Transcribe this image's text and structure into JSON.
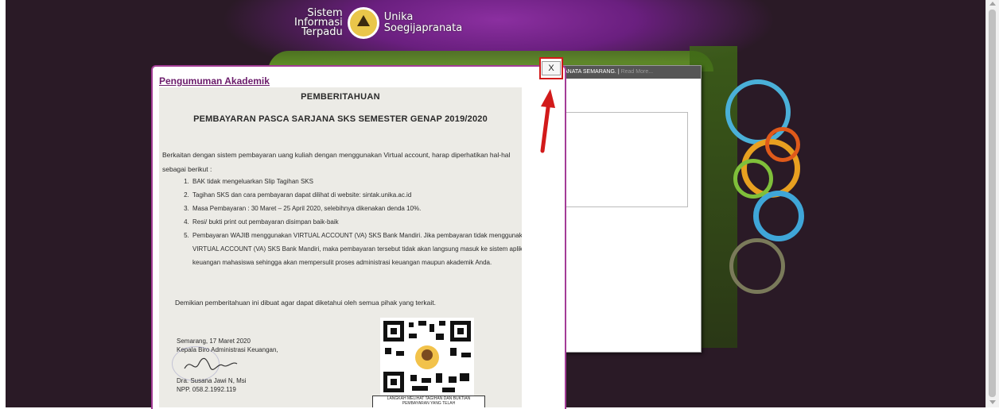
{
  "header": {
    "left_line1": "Sistem",
    "left_line2": "Informasi",
    "left_line3": "Terpadu",
    "right_line1": "Unika",
    "right_line2": "Soegijapranata"
  },
  "back_panel": {
    "bar_text": "ANATA SEMARANG.",
    "read_more": "Read More..."
  },
  "modal": {
    "title": "Pengumuman Akademik",
    "close_label": "X"
  },
  "document": {
    "heading": "PEMBERITAHUAN",
    "subheading": "PEMBAYARAN PASCA SARJANA SKS SEMESTER GENAP 2019/2020",
    "intro": "Berkaitan dengan sistem pembayaran uang kuliah dengan menggunakan Virtual account, harap diperhatikan hal-hal sebagai berikut :",
    "items": [
      "BAK tidak mengeluarkan Slip Tagihan SKS",
      "Tagihan SKS dan cara pembayaran dapat dilihat di website: sintak.unika.ac.id",
      "Masa Pembayaran : 30 Maret – 25 April 2020, selebihnya dikenakan denda 10%.",
      "Resi/ bukti print out pembayaran disimpan baik-baik",
      "Pembayaran WAJIB menggunakan VIRTUAL ACCOUNT (VA) SKS Bank Mandiri. Jika pembayaran tidak menggunakan VIRTUAL ACCOUNT (VA) SKS Bank Mandiri, maka pembayaran tersebut tidak akan langsung masuk ke sistem aplikasi keuangan mahasiswa sehingga akan mempersulit proses administrasi keuangan maupun akademik Anda."
    ],
    "closing": "Demikian pemberitahuan ini dibuat agar dapat diketahui oleh semua pihak yang terkait.",
    "place_date": "Semarang, 17 Maret 2020",
    "position": "Kepala Biro Administrasi Keuangan,",
    "signer_name": "Dra. Susana Jawi N, Msi",
    "signer_npp": "NPP. 058.2.1992.119",
    "qr_caption": "LANGKAH MELIHAT TAGIHAN DAN BUKTIAN PEMBAYARAN YANG TELAH"
  },
  "colors": {
    "modal_border": "#a33c96",
    "close_highlight": "#d21a1a",
    "title": "#6a1a6a",
    "background": "#2a1a26"
  }
}
